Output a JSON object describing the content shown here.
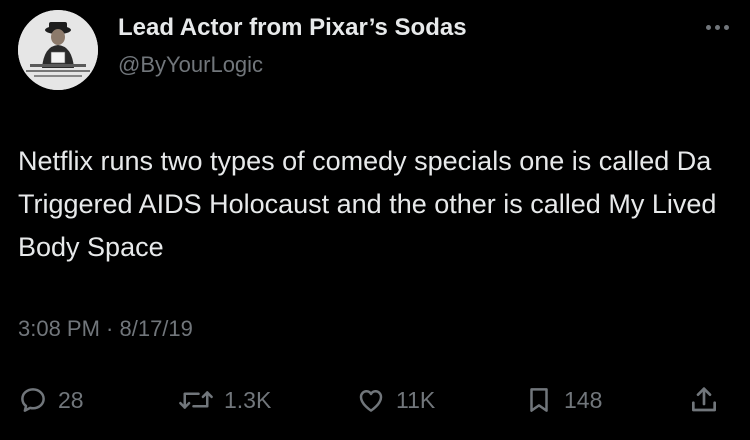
{
  "author": {
    "name": "Lead Actor from Pixar’s Sodas",
    "handle": "@ByYourLogic"
  },
  "tweet": {
    "text": "Netflix runs two types of comedy specials one is called Da Triggered AIDS Holocaust and the other is called My Lived Body Space",
    "timestamp": "3:08 PM · 8/17/19"
  },
  "actions": {
    "replies": "28",
    "retweets": "1.3K",
    "likes": "11K",
    "bookmarks": "148"
  },
  "icons": {
    "more": "more-options-icon",
    "reply": "reply-icon",
    "retweet": "retweet-icon",
    "like": "heart-icon",
    "bookmark": "bookmark-icon",
    "share": "share-icon"
  },
  "colors": {
    "background": "#000000",
    "primary_text": "#e7e9ea",
    "secondary_text": "#71767b"
  }
}
